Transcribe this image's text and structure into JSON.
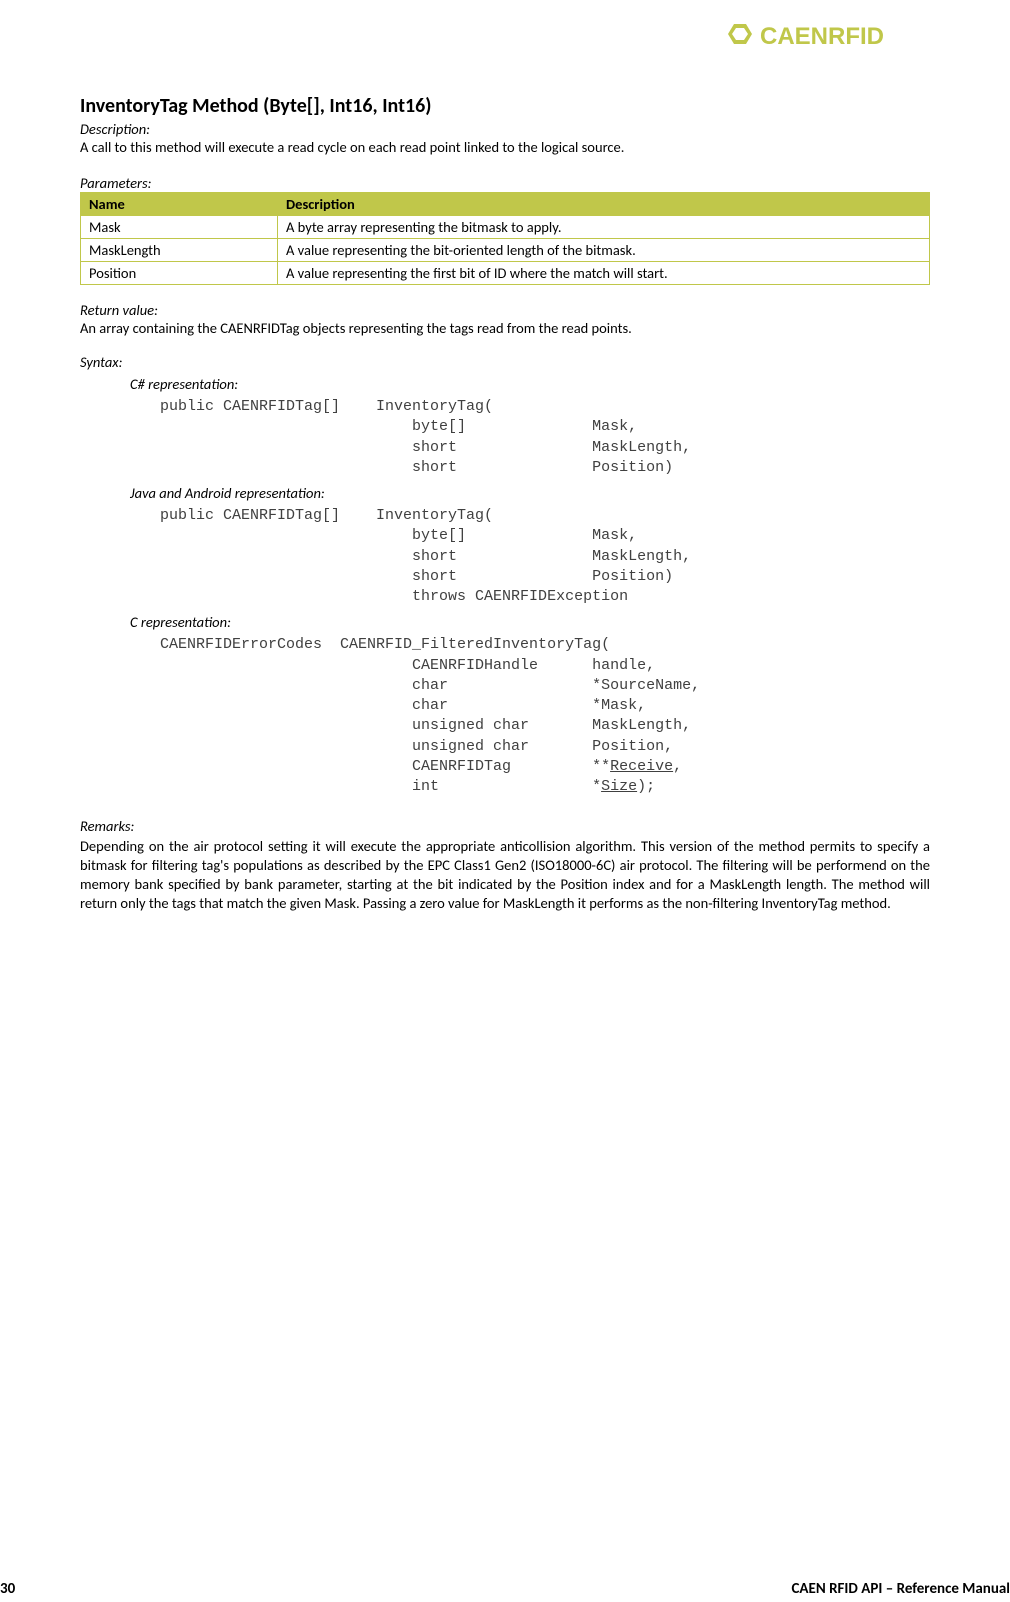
{
  "brand": "CAENRFID",
  "heading": "InventoryTag Method (Byte[], Int16, Int16)",
  "desc_label": "Description:",
  "desc_text": "A call to this method will execute a read cycle on each read point linked to the logical source.",
  "params_label": "Parameters:",
  "params_headers": {
    "name": "Name",
    "desc": "Description"
  },
  "params": [
    {
      "name": "Mask",
      "desc": "A byte array representing the bitmask to apply."
    },
    {
      "name": "MaskLength",
      "desc": "A value representing the bit-oriented length of the bitmask."
    },
    {
      "name": "Position",
      "desc": "A value representing the first bit of ID where the match will start."
    }
  ],
  "return_label": "Return value:",
  "return_text": "An array containing the CAENRFIDTag objects representing the tags read from the read points.",
  "syntax_label": "Syntax:",
  "code_cs_label": "C# representation:",
  "code_cs": "public CAENRFIDTag[]    InventoryTag(\n                            byte[]              Mask,\n                            short               MaskLength,\n                            short               Position)",
  "code_java_label": "Java and Android representation:",
  "code_java": "public CAENRFIDTag[]    InventoryTag(\n                            byte[]              Mask,\n                            short               MaskLength,\n                            short               Position)\n                            throws CAENRFIDException",
  "code_c_label": "C representation:",
  "code_c_pre": "CAENRFIDErrorCodes  CAENRFID_FilteredInventoryTag(\n                            CAENRFIDHandle      handle,\n                            char                *SourceName,\n                            char                *Mask,\n                            unsigned char       MaskLength,\n                            unsigned char       Position,\n                            CAENRFIDTag         **",
  "code_c_receive": "Receive",
  "code_c_mid": ",\n                            int                 *",
  "code_c_size": "Size",
  "code_c_end": ");",
  "remarks_label": "Remarks:",
  "remarks_text": "Depending on the air protocol setting it will execute the appropriate anticollision algorithm. This version of the method permits to specify a bitmask for filtering tag's populations as described by the EPC Class1 Gen2 (ISO18000-6C) air protocol. The filtering will be performend on the memory bank specified by bank parameter, starting at the bit indicated by the Position index and for a MaskLength length. The method will return only the tags that match the given Mask. Passing a zero value for MaskLength it performs as the non-filtering InventoryTag method.",
  "footer": {
    "page": "30",
    "title": "CAEN RFID API – Reference Manual"
  }
}
